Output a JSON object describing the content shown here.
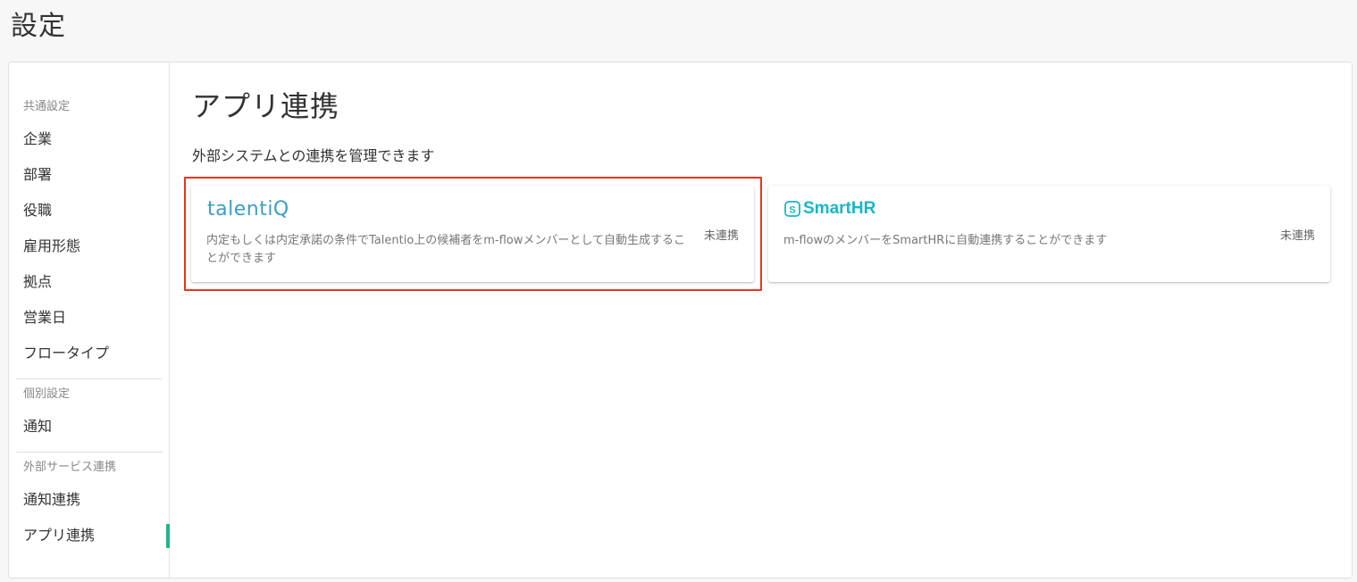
{
  "page": {
    "title": "設定"
  },
  "sidebar": {
    "sections": [
      {
        "label": "共通設定",
        "items": [
          "企業",
          "部署",
          "役職",
          "雇用形態",
          "拠点",
          "営業日",
          "フロータイプ"
        ]
      },
      {
        "label": "個別設定",
        "items": [
          "通知"
        ]
      },
      {
        "label": "外部サービス連携",
        "items": [
          "通知連携",
          "アプリ連携"
        ]
      }
    ],
    "active_item": "アプリ連携"
  },
  "main": {
    "title": "アプリ連携",
    "description": "外部システムとの連携を管理できます",
    "apps": [
      {
        "logo_text": "talentiQ",
        "description": "内定もしくは内定承諾の条件でTalentio上の候補者をm-flowメンバーとして自動生成することができます",
        "status": "未連携"
      },
      {
        "logo_text": "SmartHR",
        "description": "m-flowのメンバーをSmartHRに自動連携することができます",
        "status": "未連携"
      }
    ]
  },
  "colors": {
    "accent": "#26b389",
    "highlight": "#e8351e",
    "talentio": "#3a9fc7",
    "smarthr": "#18b6cb"
  },
  "icons": {
    "smarthr_logo": "smarthr-logo-icon"
  }
}
